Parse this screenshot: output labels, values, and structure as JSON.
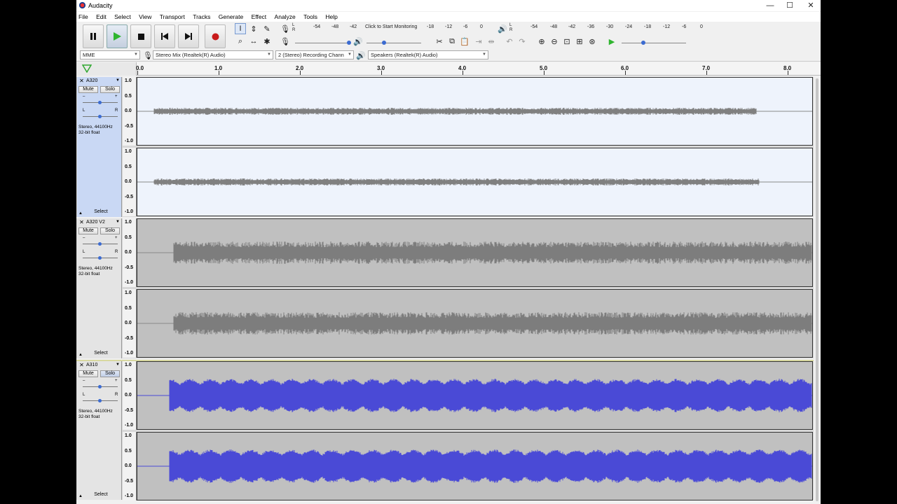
{
  "window": {
    "title": "Audacity",
    "minimize": "—",
    "maximize": "☐",
    "close": "✕"
  },
  "menu": [
    "File",
    "Edit",
    "Select",
    "View",
    "Transport",
    "Tracks",
    "Generate",
    "Effect",
    "Analyze",
    "Tools",
    "Help"
  ],
  "toolbar": {
    "rec_meter_ticks": [
      "-54",
      "-48",
      "-42",
      "Click to Start Monitoring",
      "-18",
      "-12",
      "-6",
      "0"
    ],
    "play_meter_ticks": [
      "-54",
      "-48",
      "-42",
      "-36",
      "-30",
      "-24",
      "-18",
      "-12",
      "-6",
      "0"
    ],
    "rec_lr": "L\nR",
    "host": "MME",
    "rec_device": "Stereo Mix (Realtek(R) Audio)",
    "channels": "2 (Stereo) Recording Chann",
    "play_device": "Speakers (Realtek(R) Audio)"
  },
  "ruler": {
    "ticks": [
      "0.0",
      "1.0",
      "2.0",
      "3.0",
      "4.0",
      "5.0",
      "6.0",
      "7.0",
      "8.0"
    ]
  },
  "tracks": [
    {
      "name": "A320",
      "mute": "Mute",
      "solo": "Solo",
      "info1": "Stereo, 44100Hz",
      "info2": "32-bit float",
      "select": "Select",
      "selected": true,
      "color": "#808080"
    },
    {
      "name": "A320 V2",
      "mute": "Mute",
      "solo": "Solo",
      "info1": "Stereo, 44100Hz",
      "info2": "32-bit float",
      "select": "Select",
      "selected": false,
      "color": "#7d7d7d"
    },
    {
      "name": "A310",
      "mute": "Mute",
      "solo": "Solo",
      "info1": "Stereo, 44100Hz",
      "info2": "32-bit float",
      "select": "Select",
      "selected": false,
      "color": "#4a4ad6"
    }
  ],
  "vruler_labels": [
    "1.0",
    "0.5",
    "0.0",
    "-0.5",
    "-1.0"
  ],
  "gain_label": {
    "minus": "–",
    "plus": "+",
    "l": "L",
    "r": "R"
  },
  "colors": {
    "selected_bg": "#eef3fc",
    "unselected_bg": "#c0c0c0",
    "accent": "#3b6bd1"
  }
}
